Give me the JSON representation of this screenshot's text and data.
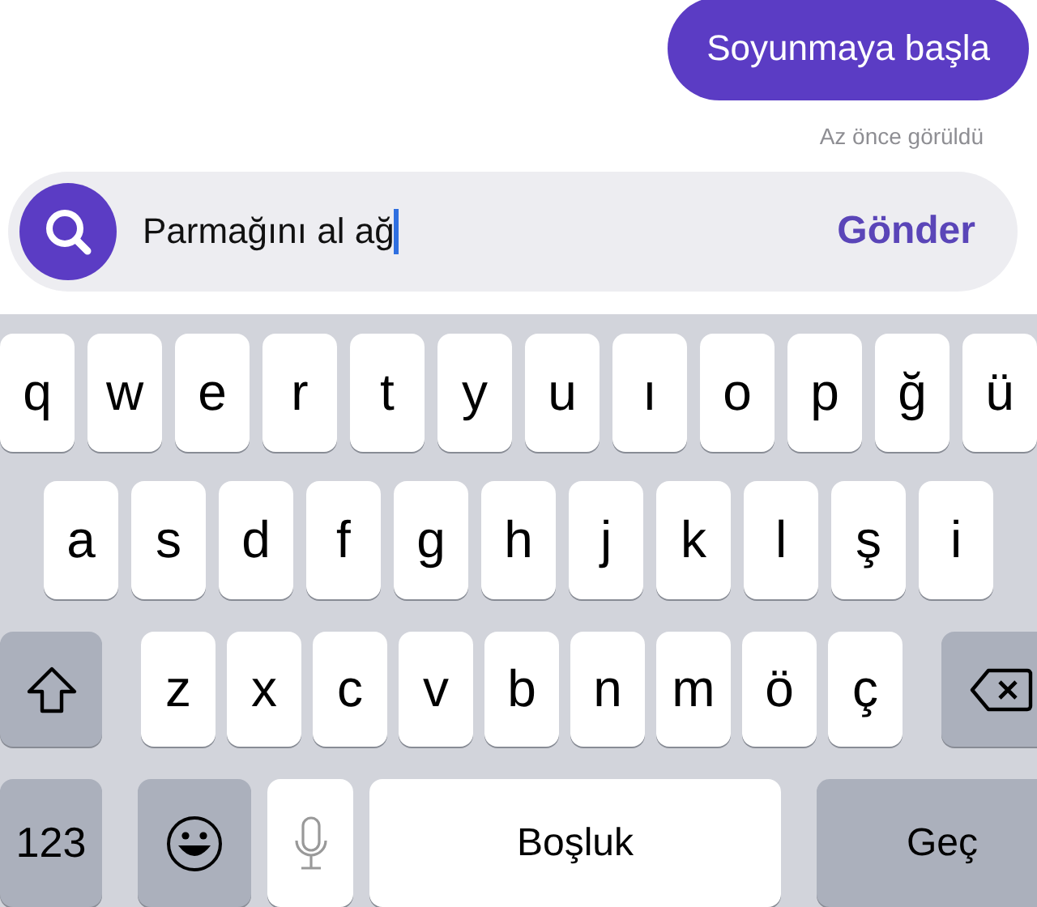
{
  "message": {
    "text": "Soyunmaya başla",
    "status": "Az önce görüldü"
  },
  "composer": {
    "value": "Parmağını al ağ",
    "send_label": "Gönder"
  },
  "keyboard": {
    "key_lines": [
      [
        {
          "kind": "letter",
          "label": "q"
        },
        {
          "kind": "letter",
          "label": "w"
        },
        {
          "kind": "letter",
          "label": "e"
        },
        {
          "kind": "letter",
          "label": "r"
        },
        {
          "kind": "letter",
          "label": "t"
        },
        {
          "kind": "letter",
          "label": "y"
        },
        {
          "kind": "letter",
          "label": "u"
        },
        {
          "kind": "letter",
          "label": "ı"
        },
        {
          "kind": "letter",
          "label": "o"
        },
        {
          "kind": "letter",
          "label": "p"
        },
        {
          "kind": "letter",
          "label": "ğ"
        },
        {
          "kind": "letter",
          "label": "ü"
        }
      ],
      [
        {
          "kind": "letter",
          "label": "a"
        },
        {
          "kind": "letter",
          "label": "s"
        },
        {
          "kind": "letter",
          "label": "d"
        },
        {
          "kind": "letter",
          "label": "f"
        },
        {
          "kind": "letter",
          "label": "g"
        },
        {
          "kind": "letter",
          "label": "h"
        },
        {
          "kind": "letter",
          "label": "j"
        },
        {
          "kind": "letter",
          "label": "k"
        },
        {
          "kind": "letter",
          "label": "l"
        },
        {
          "kind": "letter",
          "label": "ş"
        },
        {
          "kind": "letter",
          "label": "i"
        }
      ],
      [
        {
          "kind": "shift"
        },
        {
          "kind": "letter",
          "label": "z"
        },
        {
          "kind": "letter",
          "label": "x"
        },
        {
          "kind": "letter",
          "label": "c"
        },
        {
          "kind": "letter",
          "label": "v"
        },
        {
          "kind": "letter",
          "label": "b"
        },
        {
          "kind": "letter",
          "label": "n"
        },
        {
          "kind": "letter",
          "label": "m"
        },
        {
          "kind": "letter",
          "label": "ö"
        },
        {
          "kind": "letter",
          "label": "ç"
        },
        {
          "kind": "backspace"
        }
      ],
      [
        {
          "kind": "numbers",
          "label": "123"
        },
        {
          "kind": "emoji"
        },
        {
          "kind": "mic"
        },
        {
          "kind": "space",
          "label": "Boşluk"
        },
        {
          "kind": "return",
          "label": "Geç"
        }
      ]
    ]
  }
}
